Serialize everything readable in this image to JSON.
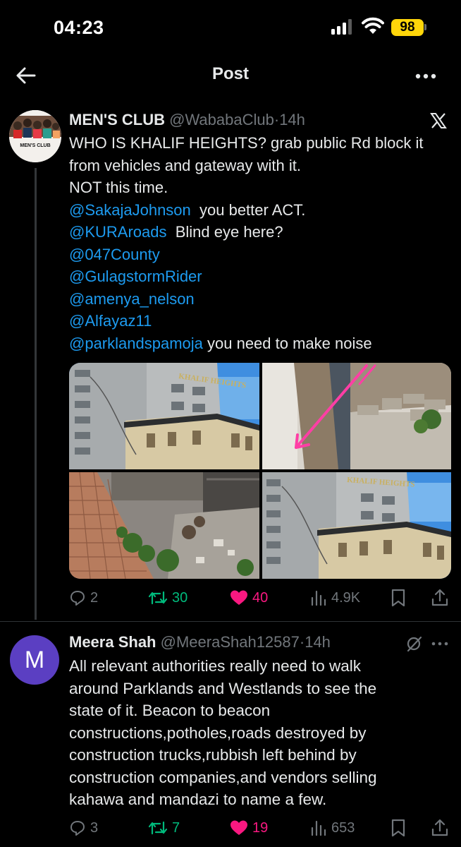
{
  "status_bar": {
    "time": "04:23",
    "battery": "98"
  },
  "header": {
    "title": "Post"
  },
  "tweet1": {
    "name": "MEN'S CLUB",
    "handle": "@WababaClub",
    "sep": "·",
    "time": "14h",
    "avatar_label": "MEN'S CLUB",
    "lines": [
      {
        "text": "WHO IS KHALIF HEIGHTS? grab public Rd block it"
      },
      {
        "text": "from vehicles and gateway with it."
      },
      {
        "text": "NOT this time."
      },
      {
        "mention": "@SakajaJohnson",
        "text": "  you better ACT."
      },
      {
        "mention": "@KURAroads",
        "text": "  Blind eye here?"
      },
      {
        "mention": "@047County",
        "text": ""
      },
      {
        "mention": "@GulagstormRider",
        "text": ""
      },
      {
        "mention": "@amenya_nelson",
        "text": ""
      },
      {
        "mention": "@Alfayaz11",
        "text": ""
      },
      {
        "mention": "@parklandspamoja",
        "text": " you need to make noise"
      }
    ],
    "building_sign": "KHALIF HEIGHTS",
    "stats": {
      "replies": "2",
      "reposts": "30",
      "likes": "40",
      "views": "4.9K"
    }
  },
  "tweet2": {
    "avatar_letter": "M",
    "name": "Meera Shah",
    "handle": "@MeeraShah12587",
    "sep": "·",
    "time": "14h",
    "lines": [
      "All relevant authorities really need to walk",
      "around Parklands and Westlands to see the",
      "state of it. Beacon to beacon",
      "constructions,potholes,roads destroyed by",
      "construction trucks,rubbish left behind by",
      "construction companies,and vendors selling",
      "kahawa and mandazi to name a few."
    ],
    "stats": {
      "replies": "3",
      "reposts": "7",
      "likes": "19",
      "views": "653"
    }
  },
  "colors": {
    "background": "#000000",
    "text": "#e7e9ea",
    "secondary": "#71767b",
    "link": "#1d9bf0",
    "repost": "#00ba7c",
    "like": "#f91880",
    "battery": "#ffd60a",
    "avatar2": "#5b3fc2"
  },
  "icons": [
    "back-arrow-icon",
    "more-icon",
    "x-logo-icon",
    "reply-icon",
    "repost-icon",
    "heart-icon",
    "views-icon",
    "bookmark-icon",
    "share-icon",
    "grok-icon"
  ]
}
